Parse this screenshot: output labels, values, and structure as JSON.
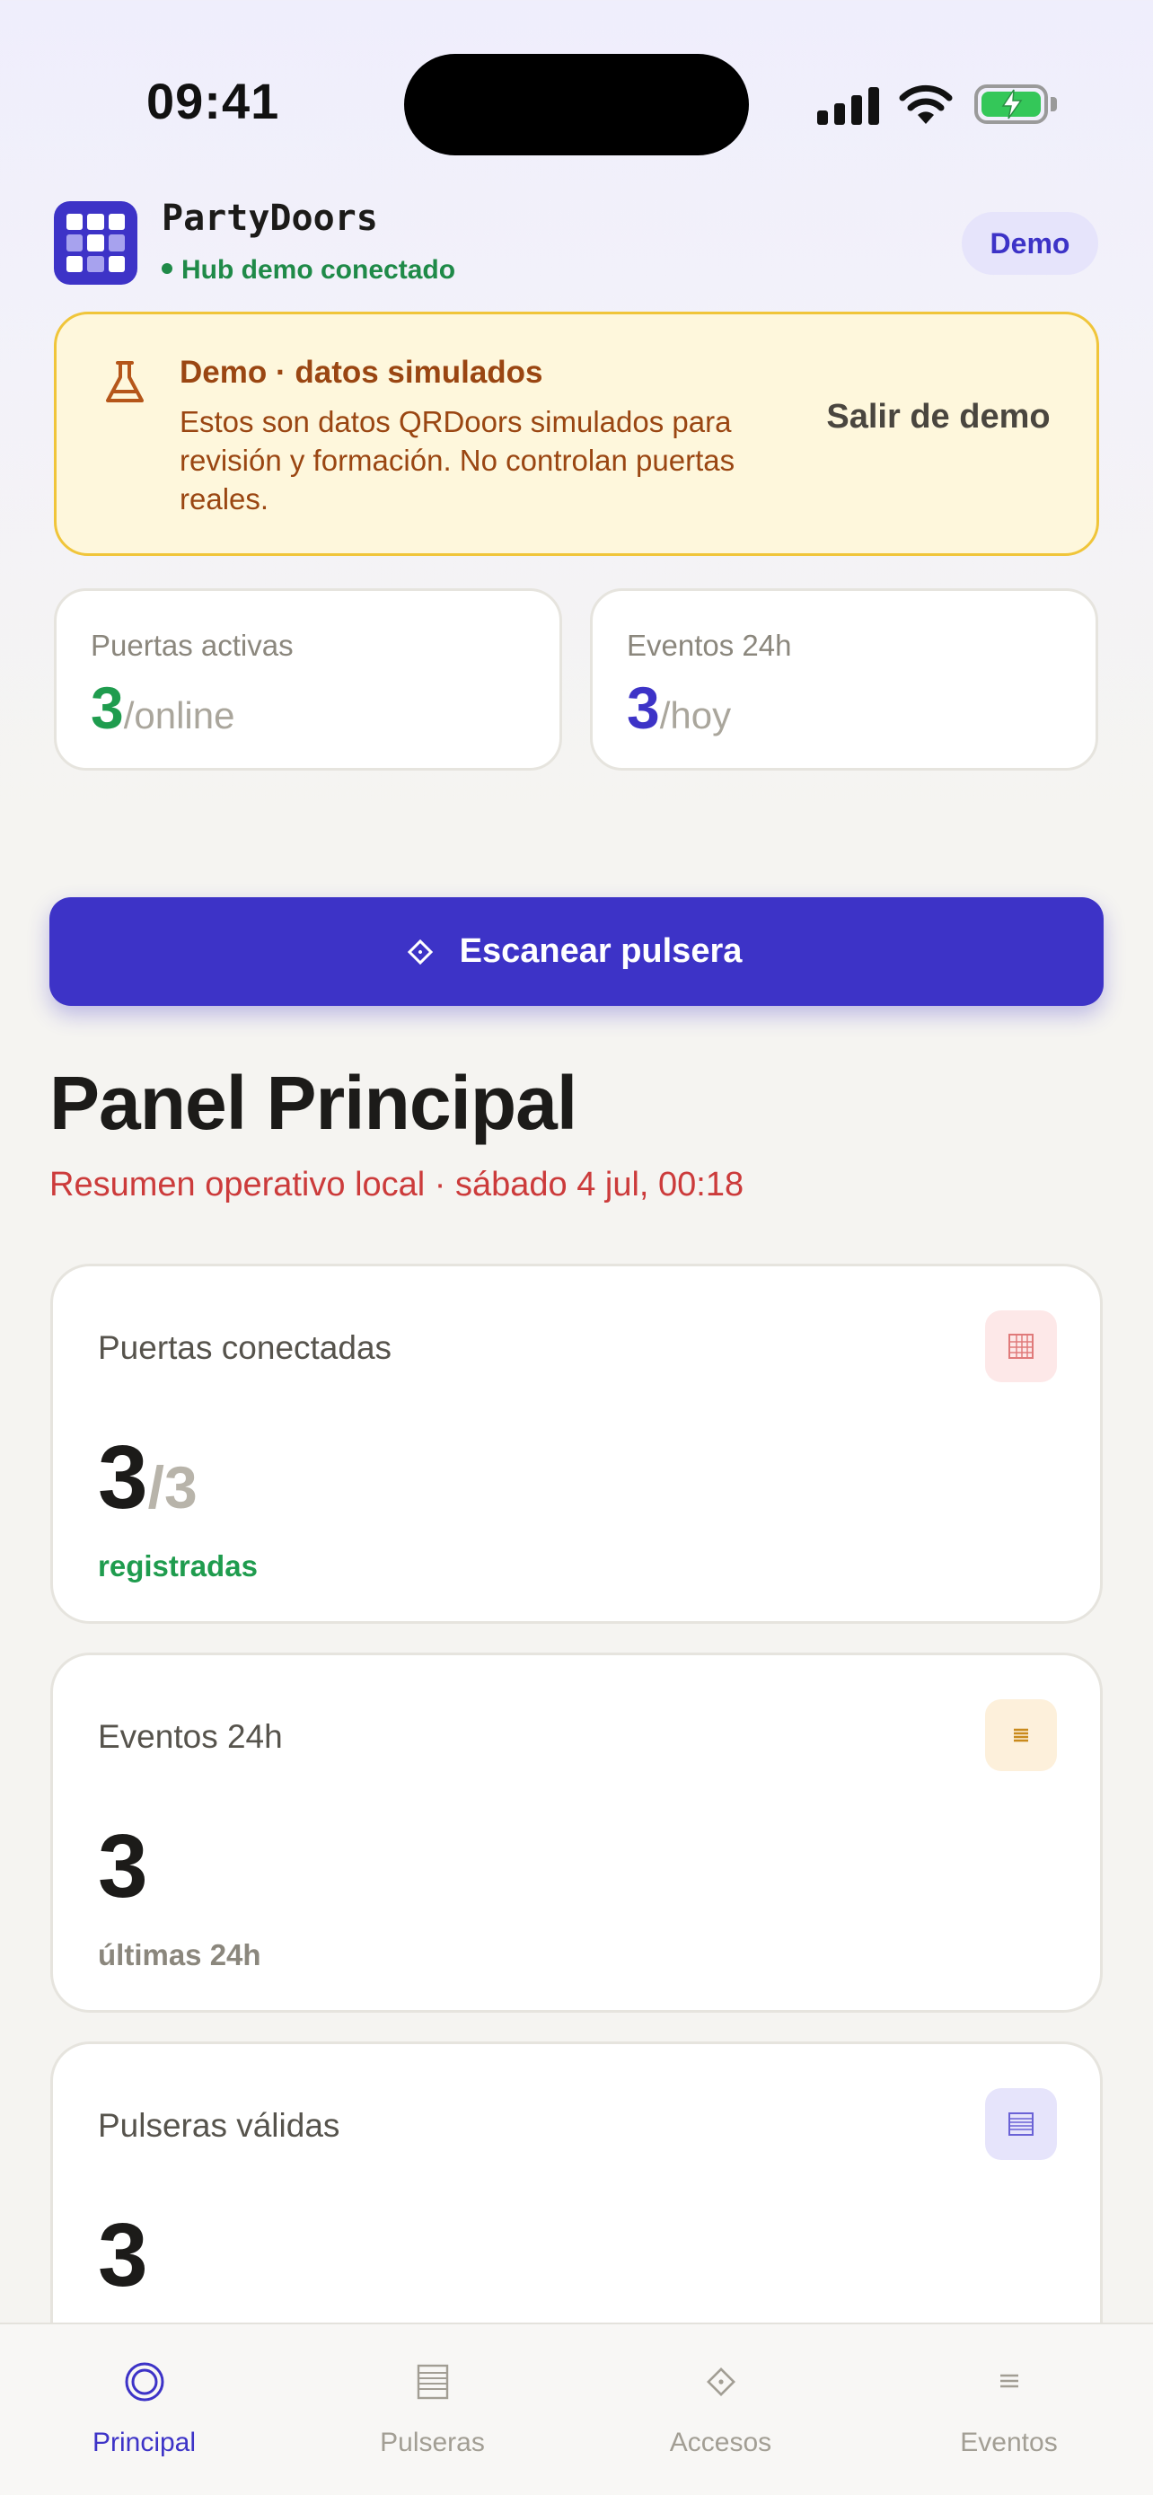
{
  "status_bar": {
    "time": "09:41"
  },
  "header": {
    "app_name": "PartyDoors",
    "hub_status": "Hub demo conectado",
    "demo_badge": "Demo"
  },
  "demo_banner": {
    "title": "Demo · datos simulados",
    "text": "Estos son datos QRDoors simulados para revisión y formación. No controlan puertas reales.",
    "exit_label": "Salir de demo",
    "icon": "flask-icon"
  },
  "mini_stats": [
    {
      "label": "Puertas activas",
      "value": "3",
      "suffix": "/online",
      "color": "#1f9c4e"
    },
    {
      "label": "Eventos 24h",
      "value": "3",
      "suffix": "/hoy",
      "color": "#3d33c7"
    }
  ],
  "scan_button": {
    "label": "Escanear pulsera",
    "icon": "scan-icon"
  },
  "panel": {
    "title": "Panel Principal",
    "subtitle": "Resumen operativo local · sábado 4 jul, 00:18"
  },
  "metrics": [
    {
      "label": "Puertas conectadas",
      "value": "3",
      "fraction": "/3",
      "note": "registradas",
      "note_color": "#1f9c4e",
      "icon": "door-grid-icon",
      "icon_bg": "#fde8e8",
      "icon_color": "#e07a7a"
    },
    {
      "label": "Eventos 24h",
      "value": "3",
      "fraction": "",
      "note": "últimas 24h",
      "note_color": "#8b877d",
      "icon": "list-icon",
      "icon_bg": "#fdf0db",
      "icon_color": "#c98a1c"
    },
    {
      "label": "Pulseras válidas",
      "value": "3",
      "fraction": "",
      "note": "",
      "note_color": "#8b877d",
      "icon": "wristband-icon",
      "icon_bg": "#e6e4fb",
      "icon_color": "#6a62d6"
    }
  ],
  "bottom_nav": [
    {
      "label": "Principal",
      "icon": "target-icon",
      "active": true
    },
    {
      "label": "Pulseras",
      "icon": "lines-icon",
      "active": false
    },
    {
      "label": "Accesos",
      "icon": "diamond-icon",
      "active": false
    },
    {
      "label": "Eventos",
      "icon": "menu-icon",
      "active": false
    }
  ],
  "colors": {
    "accent": "#3d33c7",
    "success": "#1f9c4e",
    "warning_bg": "#fef7dc",
    "warning_border": "#f0c53a",
    "warning_text": "#9a4612",
    "subtitle_red": "#cc3b3b"
  }
}
